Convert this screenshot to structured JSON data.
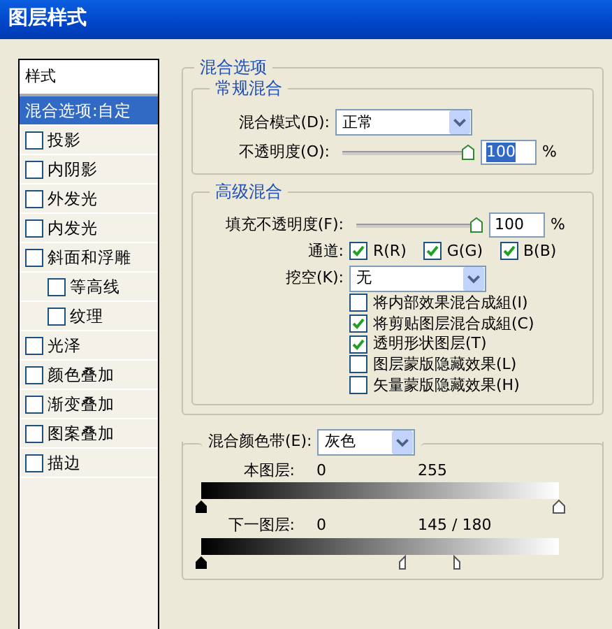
{
  "window": {
    "title": "图层样式"
  },
  "styles": {
    "title": "样式",
    "items": [
      {
        "label": "混合选项:自定",
        "kind": "plain",
        "selected": true
      },
      {
        "label": "投影",
        "kind": "checkbox",
        "checked": false,
        "selected": false
      },
      {
        "label": "内阴影",
        "kind": "checkbox",
        "checked": false,
        "selected": false
      },
      {
        "label": "外发光",
        "kind": "checkbox",
        "checked": false,
        "selected": false
      },
      {
        "label": "内发光",
        "kind": "checkbox",
        "checked": false,
        "selected": false
      },
      {
        "label": "斜面和浮雕",
        "kind": "checkbox",
        "checked": false,
        "selected": false,
        "children": [
          {
            "label": "等高线",
            "kind": "checkbox",
            "checked": false,
            "selected": false
          },
          {
            "label": "纹理",
            "kind": "checkbox",
            "checked": false,
            "selected": false
          }
        ]
      },
      {
        "label": "光泽",
        "kind": "checkbox",
        "checked": false,
        "selected": false
      },
      {
        "label": "颜色叠加",
        "kind": "checkbox",
        "checked": false,
        "selected": false
      },
      {
        "label": "渐变叠加",
        "kind": "checkbox",
        "checked": false,
        "selected": false
      },
      {
        "label": "图案叠加",
        "kind": "checkbox",
        "checked": false,
        "selected": false
      },
      {
        "label": "描边",
        "kind": "checkbox",
        "checked": false,
        "selected": false
      }
    ]
  },
  "blending_options": {
    "title": "混合选项",
    "general": {
      "title": "常规混合",
      "mode_label": "混合模式(D):",
      "mode": "正常",
      "opacity_label": "不透明度(O):",
      "opacity": {
        "level": 1,
        "value": "100",
        "selected": true
      },
      "unit": "%"
    },
    "advanced": {
      "title": "高级混合",
      "fill_label": "填充不透明度(F):",
      "fill": {
        "level": 1,
        "value": "100",
        "selected": false
      },
      "unit": "%",
      "channels_label": "通道:",
      "channels": [
        {
          "label": "R(R)",
          "checked": true
        },
        {
          "label": "G(G)",
          "checked": true
        },
        {
          "label": "B(B)",
          "checked": true
        }
      ],
      "knockout_label": "挖空(K):",
      "knockout": "无",
      "options": [
        {
          "label": "将内部效果混合成組(I)",
          "checked": false
        },
        {
          "label": "将剪贴图层混合成組(C)",
          "checked": true
        },
        {
          "label": "透明形状图层(T)",
          "checked": true
        },
        {
          "label": "图层蒙版隐藏效果(L)",
          "checked": false
        },
        {
          "label": "矢量蒙版隐藏效果(H)",
          "checked": false
        }
      ]
    },
    "blend_if": {
      "label": "混合颜色带(E):",
      "value": "灰色",
      "bands": [
        {
          "label": "本图层:",
          "low": "0",
          "high": "255",
          "thumbs": [
            {
              "kind": "black",
              "level": 0
            },
            {
              "kind": "white",
              "level": 1
            }
          ]
        },
        {
          "label": "下一图层:",
          "low": "0",
          "high": "145 / 180",
          "thumbs": [
            {
              "kind": "black",
              "level": 0
            },
            {
              "kind": "white-left",
              "level": 0.569
            },
            {
              "kind": "white-right",
              "level": 0.706
            }
          ]
        }
      ]
    }
  }
}
